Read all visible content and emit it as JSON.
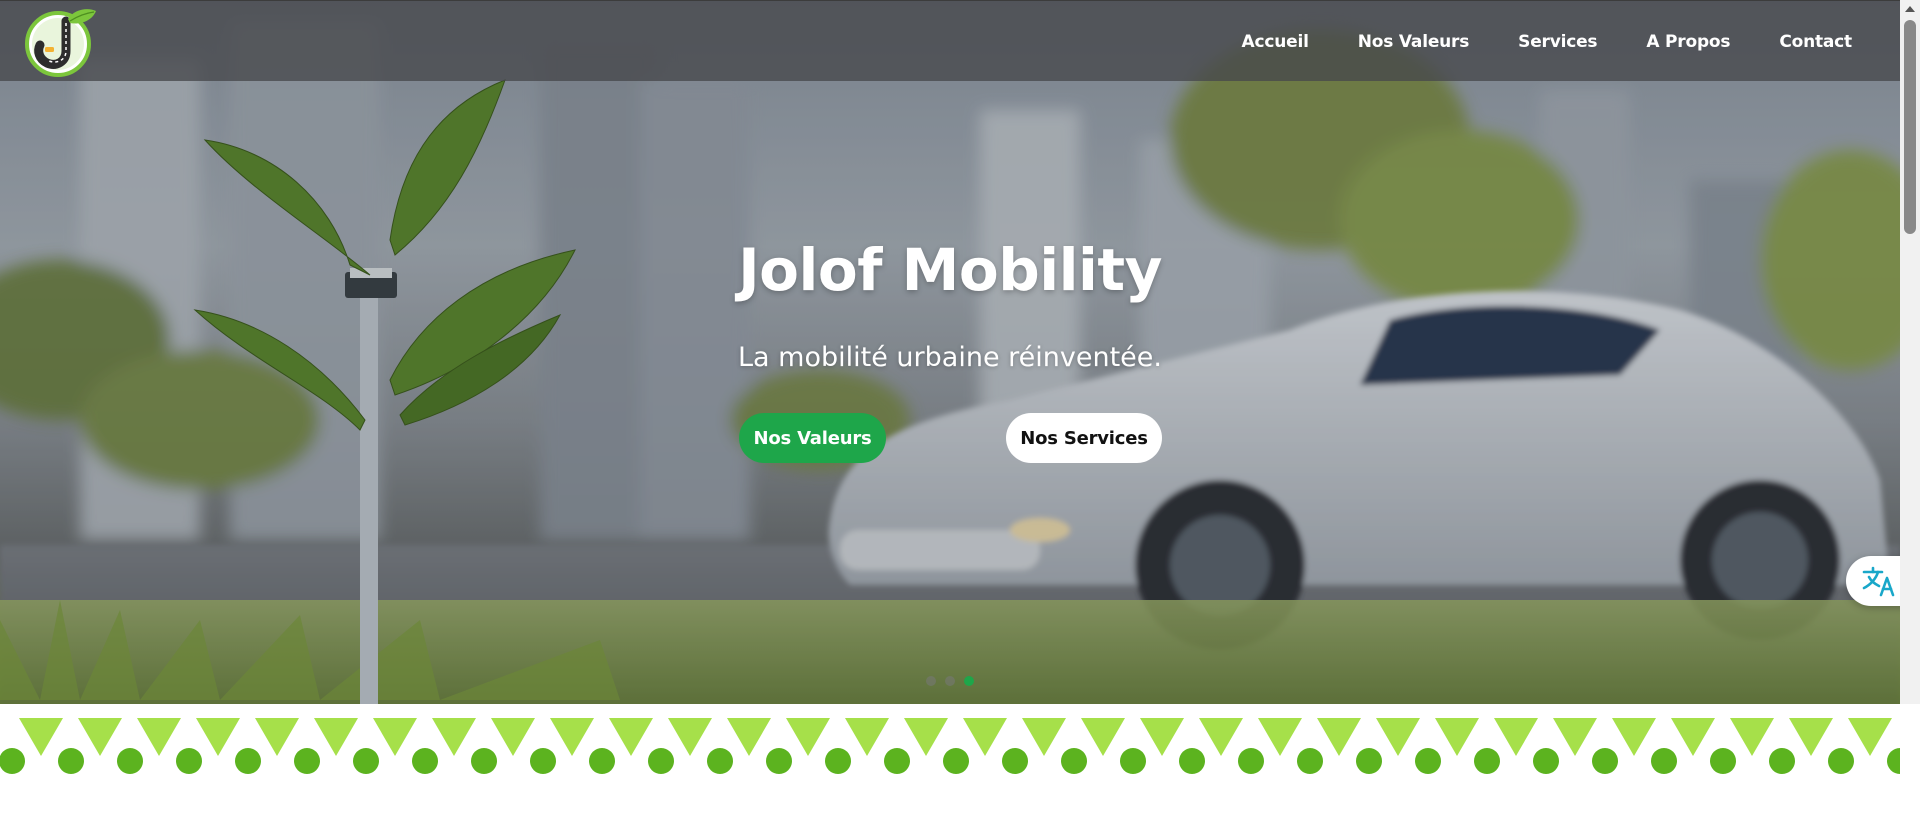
{
  "brand": {
    "logo_icon": "jolof-road-leaf-logo",
    "colors": {
      "accent": "#1ea64a",
      "light_green": "#a6e04a",
      "dark_green": "#5cb31f",
      "translate_icon": "#19a7c9"
    }
  },
  "nav": {
    "items": [
      {
        "label": "Accueil"
      },
      {
        "label": "Nos Valeurs"
      },
      {
        "label": "Services"
      },
      {
        "label": "A Propos"
      },
      {
        "label": "Contact"
      }
    ]
  },
  "hero": {
    "title": "Jolof Mobility",
    "subtitle": "La mobilité urbaine réinventée.",
    "primary_button": "Nos Valeurs",
    "secondary_button": "Nos Services",
    "carousel": {
      "slides": 3,
      "active": 3
    }
  },
  "translate": {
    "icon": "translate-icon"
  }
}
